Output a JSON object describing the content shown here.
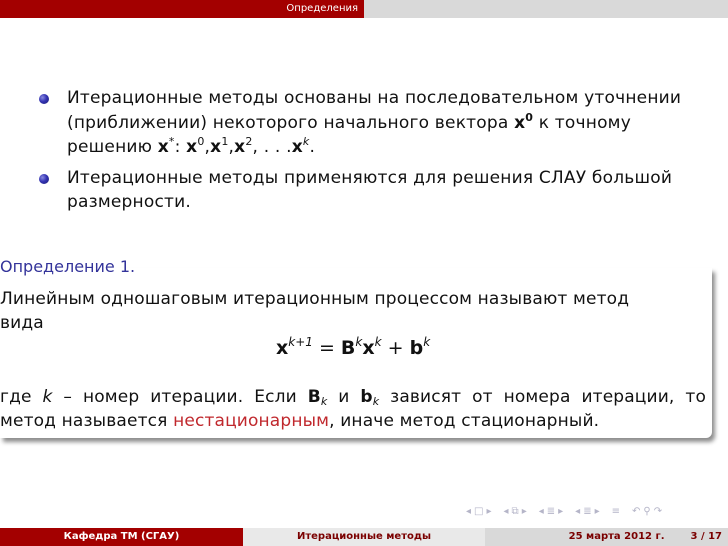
{
  "header": {
    "section_title": "Определения",
    "accent_color": "#a30000"
  },
  "bullets": [
    {
      "icon": "bullet-ball-icon",
      "line1": "Итерационные методы основаны на последовательном уточнении",
      "line2_pre": "(приближении) некоторого начального вектора",
      "line2_vec": "x",
      "line2_sup": "0",
      "line2_post": "к точному",
      "line3_pre": "решению",
      "line3_math": [
        {
          "base": "x",
          "sup": "*",
          "after": ":"
        },
        {
          "base": "x",
          "sup": "0",
          "after": ","
        },
        {
          "base": "x",
          "sup": "1",
          "after": ","
        },
        {
          "base": "x",
          "sup": "2",
          "after": ", . . ."
        },
        {
          "base": "x",
          "sup": "k",
          "after": "."
        }
      ]
    },
    {
      "icon": "bullet-ball-icon",
      "line1": "Итерационные методы применяются для решения СЛАУ большой",
      "line2": "размерности."
    }
  ],
  "definition": {
    "title": "Определение 1.",
    "title_color": "#33339a",
    "line1": "Линейным одношаговым итерационным процессом называют метод",
    "line2": "вида",
    "formula": {
      "lhs_base": "x",
      "lhs_sup": "k+1",
      "eq": "=",
      "B": "B",
      "B_sup": "k",
      "x": "x",
      "x_sup": "k",
      "plus": "+",
      "b": "b",
      "b_sup": "k"
    },
    "after_line1_words": [
      "где",
      "k",
      "–",
      "номер",
      "итерации.",
      "Если",
      "B",
      "k",
      "и",
      "b",
      "k",
      "зависят",
      "от",
      "номера",
      "итерации,",
      "то"
    ],
    "after_line2_pre": "метод называется ",
    "after_line2_alert": "нестационарным",
    "after_line2_post": ", иначе метод стационарный.",
    "alert_color": "#c0282d"
  },
  "nav": {
    "icons": [
      "nav-frame-left",
      "nav-frame",
      "nav-frame-right",
      "nav-subsection-left",
      "nav-subsection",
      "nav-subsection-right",
      "nav-section-left",
      "nav-section",
      "nav-section-right",
      "nav-section-left-2",
      "nav-subsection-2",
      "nav-section-right-2",
      "nav-align",
      "nav-back",
      "nav-search",
      "nav-forward"
    ]
  },
  "footer": {
    "author": "Кафедра ТМ (СГАУ)",
    "title": "Итерационные методы",
    "date": "25 марта 2012 г.",
    "page": "3 / 17"
  }
}
